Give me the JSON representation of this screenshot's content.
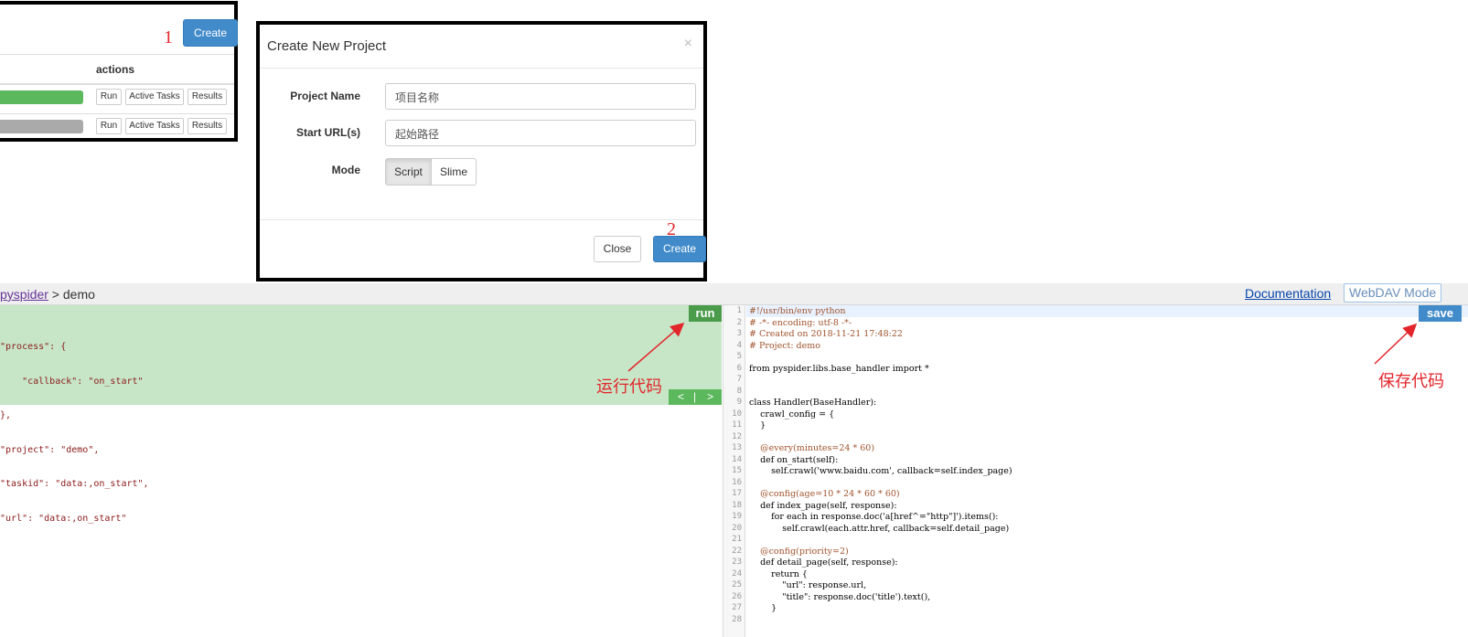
{
  "project_list": {
    "create_label": "Create",
    "actions_header": "actions",
    "rows": [
      {
        "status_color": "#5cb85c",
        "run": "Run",
        "active_tasks": "Active Tasks",
        "results": "Results"
      },
      {
        "status_color": "#aaaaaa",
        "run": "Run",
        "active_tasks": "Active Tasks",
        "results": "Results"
      }
    ]
  },
  "annotations": {
    "step1": "1",
    "step2": "2",
    "run_code": "运行代码",
    "save_code": "保存代码"
  },
  "modal": {
    "title": "Create New Project",
    "close_x": "×",
    "project_name_label": "Project Name",
    "project_name_placeholder": "项目名称",
    "start_url_label": "Start URL(s)",
    "start_url_placeholder": "起始路径",
    "mode_label": "Mode",
    "mode_options": [
      "Script",
      "Slime"
    ],
    "mode_selected": "Script",
    "close_label": "Close",
    "create_label": "Create"
  },
  "debugger": {
    "breadcrumb_root": "pyspider",
    "breadcrumb_sep": " > ",
    "breadcrumb_project": "demo",
    "documentation_link": "Documentation",
    "webdav_label": "WebDAV Mode",
    "run_label": "run",
    "save_label": "save",
    "pager_prev": "<",
    "pager_sep": "|",
    "pager_next": ">",
    "task_lines": [
      "\"process\": {",
      "    \"callback\": \"on_start\"",
      "},",
      "\"project\": \"demo\",",
      "\"taskid\": \"data:,on_start\",",
      "\"url\": \"data:,on_start\""
    ],
    "code_lines": [
      "#!/usr/bin/env python",
      "# -*- encoding: utf-8 -*-",
      "# Created on 2018-11-21 17:48:22",
      "# Project: demo",
      "",
      "from pyspider.libs.base_handler import *",
      "",
      "",
      "class Handler(BaseHandler):",
      "    crawl_config = {",
      "    }",
      "",
      "    @every(minutes=24 * 60)",
      "    def on_start(self):",
      "        self.crawl('www.baidu.com', callback=self.index_page)",
      "",
      "    @config(age=10 * 24 * 60 * 60)",
      "    def index_page(self, response):",
      "        for each in response.doc('a[href^=\"http\"]').items():",
      "            self.crawl(each.attr.href, callback=self.detail_page)",
      "",
      "    @config(priority=2)",
      "    def detail_page(self, response):",
      "        return {",
      "            \"url\": response.url,",
      "            \"title\": response.doc('title').text(),",
      "        }",
      ""
    ]
  },
  "colors": {
    "primary": "#428bca",
    "success": "#5cb85c",
    "task_bg": "#c7e6c7",
    "annotation": "#e2262b"
  }
}
